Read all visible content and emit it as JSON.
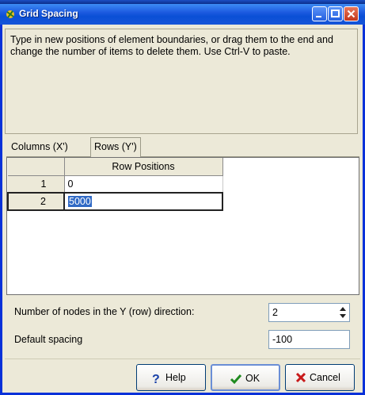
{
  "window": {
    "title": "Grid Spacing"
  },
  "info": {
    "text": "Type in new positions of element boundaries, or drag them to the end and change the number of items to delete them.  Use Ctrl-V to paste."
  },
  "tabs": [
    {
      "label": "Columns (X')",
      "active": false
    },
    {
      "label": "Rows (Y')",
      "active": true
    }
  ],
  "grid": {
    "column_header": "Row Positions",
    "rows": [
      {
        "index": "1",
        "value": "0"
      },
      {
        "index": "2",
        "value": "5000"
      }
    ],
    "editing_row": 2
  },
  "nodes": {
    "label": "Number of nodes in the Y (row) direction:",
    "value": "2"
  },
  "spacing": {
    "label": "Default spacing",
    "value": "-100"
  },
  "buttons": {
    "help": "Help",
    "ok": "OK",
    "cancel": "Cancel"
  },
  "colors": {
    "title_bar": "#0a4fd6",
    "selection": "#316ac5",
    "cancel_icon": "#c81a1a",
    "ok_icon": "#1f8a1f",
    "help_icon": "#1840a8"
  }
}
